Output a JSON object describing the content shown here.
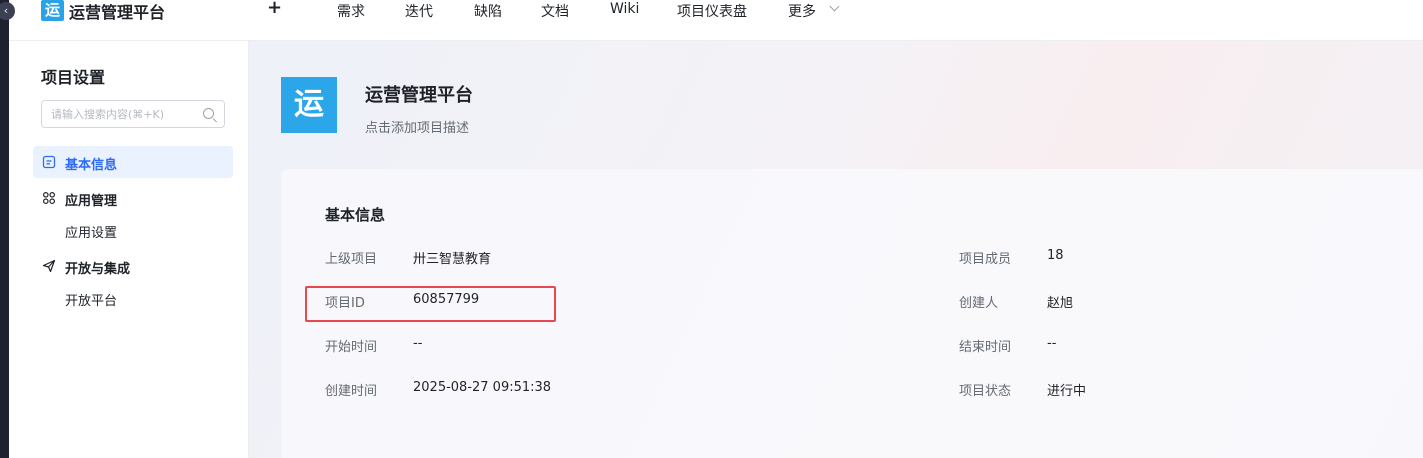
{
  "topnav": {
    "logo_char": "运",
    "app_title": "运营管理平台",
    "add_label": "+",
    "items": [
      {
        "label": "需求"
      },
      {
        "label": "迭代"
      },
      {
        "label": "缺陷"
      },
      {
        "label": "文档"
      },
      {
        "label": "Wiki"
      },
      {
        "label": "项目仪表盘"
      },
      {
        "label": "更多"
      }
    ]
  },
  "rail": {
    "collapse_glyph": "‹"
  },
  "sidebar": {
    "title": "项目设置",
    "search_placeholder": "请输入搜索内容(⌘+K)",
    "items": [
      {
        "label": "基本信息",
        "icon": "info-card-icon",
        "active": true
      },
      {
        "label": "应用管理",
        "icon": "apps-grid-icon"
      },
      {
        "label": "应用设置"
      },
      {
        "label": "开放与集成",
        "icon": "send-icon"
      },
      {
        "label": "开放平台"
      }
    ]
  },
  "project": {
    "badge_char": "运",
    "name": "运营管理平台",
    "description": "点击添加项目描述"
  },
  "basic_info": {
    "title": "基本信息",
    "left": [
      {
        "label": "上级项目",
        "value": "卅三智慧教育"
      },
      {
        "label": "项目ID",
        "value": "60857799"
      },
      {
        "label": "开始时间",
        "value": "--"
      },
      {
        "label": "创建时间",
        "value": "2025-08-27 09:51:38"
      }
    ],
    "right": [
      {
        "label": "项目成员",
        "value": "18"
      },
      {
        "label": "创建人",
        "value": "赵旭"
      },
      {
        "label": "结束时间",
        "value": "--"
      },
      {
        "label": "项目状态",
        "value": "进行中"
      }
    ]
  },
  "colors": {
    "accent": "#2e6bf6",
    "brand_badge": "#2ba6e9",
    "highlight": "#e5484d"
  }
}
